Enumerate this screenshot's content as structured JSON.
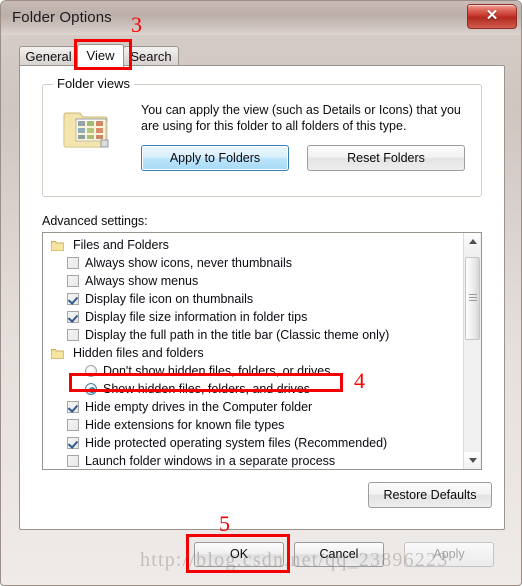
{
  "window": {
    "title": "Folder Options",
    "close_label": "✕"
  },
  "tabs": [
    {
      "label": "General",
      "selected": false
    },
    {
      "label": "View",
      "selected": true
    },
    {
      "label": "Search",
      "selected": false
    }
  ],
  "folder_views": {
    "legend": "Folder views",
    "description": "You can apply the view (such as Details or Icons) that you are using for this folder to all folders of this type.",
    "apply_button": "Apply to Folders",
    "reset_button": "Reset Folders",
    "icon": "folder-view-icon"
  },
  "advanced": {
    "label": "Advanced settings:",
    "items": [
      {
        "type": "group",
        "label": "Files and Folders",
        "state": null
      },
      {
        "type": "checkbox",
        "label": "Always show icons, never thumbnails",
        "state": "unchecked"
      },
      {
        "type": "checkbox",
        "label": "Always show menus",
        "state": "unchecked"
      },
      {
        "type": "checkbox",
        "label": "Display file icon on thumbnails",
        "state": "checked"
      },
      {
        "type": "checkbox",
        "label": "Display file size information in folder tips",
        "state": "checked"
      },
      {
        "type": "checkbox",
        "label": "Display the full path in the title bar (Classic theme only)",
        "state": "unchecked"
      },
      {
        "type": "group",
        "label": "Hidden files and folders",
        "state": null
      },
      {
        "type": "radio",
        "label": "Don't show hidden files, folders, or drives",
        "state": "unselected"
      },
      {
        "type": "radio",
        "label": "Show hidden files, folders, and drives",
        "state": "selected"
      },
      {
        "type": "checkbox",
        "label": "Hide empty drives in the Computer folder",
        "state": "checked"
      },
      {
        "type": "checkbox",
        "label": "Hide extensions for known file types",
        "state": "unchecked"
      },
      {
        "type": "checkbox",
        "label": "Hide protected operating system files (Recommended)",
        "state": "checked"
      },
      {
        "type": "checkbox",
        "label": "Launch folder windows in a separate process",
        "state": "unchecked"
      }
    ],
    "restore_defaults_button": "Restore Defaults"
  },
  "footer": {
    "ok": "OK",
    "cancel": "Cancel",
    "apply": "Apply"
  },
  "annotations": {
    "step3": "3",
    "step4": "4",
    "step5": "5",
    "highlight_color": "#fd0000"
  },
  "watermark": "http://blog.csdn.net/qq_23896223"
}
